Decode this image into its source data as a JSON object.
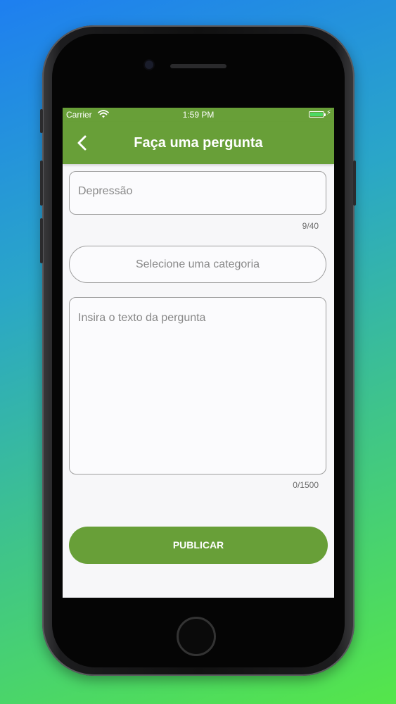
{
  "status_bar": {
    "carrier": "Carrier",
    "time": "1:59 PM",
    "battery_level": 1.0
  },
  "nav": {
    "title": "Faça uma pergunta",
    "back_icon": "chevron-left-icon"
  },
  "form": {
    "title_input": {
      "value": "Depressão",
      "counter": "9/40"
    },
    "category_select": {
      "placeholder": "Selecione uma categoria"
    },
    "body_input": {
      "placeholder": "Insira o texto da pergunta",
      "counter": "0/1500"
    },
    "publish_label": "PUBLICAR"
  },
  "colors": {
    "brand_green": "#689f38",
    "background_top": "#1e7ff0",
    "background_bottom": "#55e64a"
  }
}
